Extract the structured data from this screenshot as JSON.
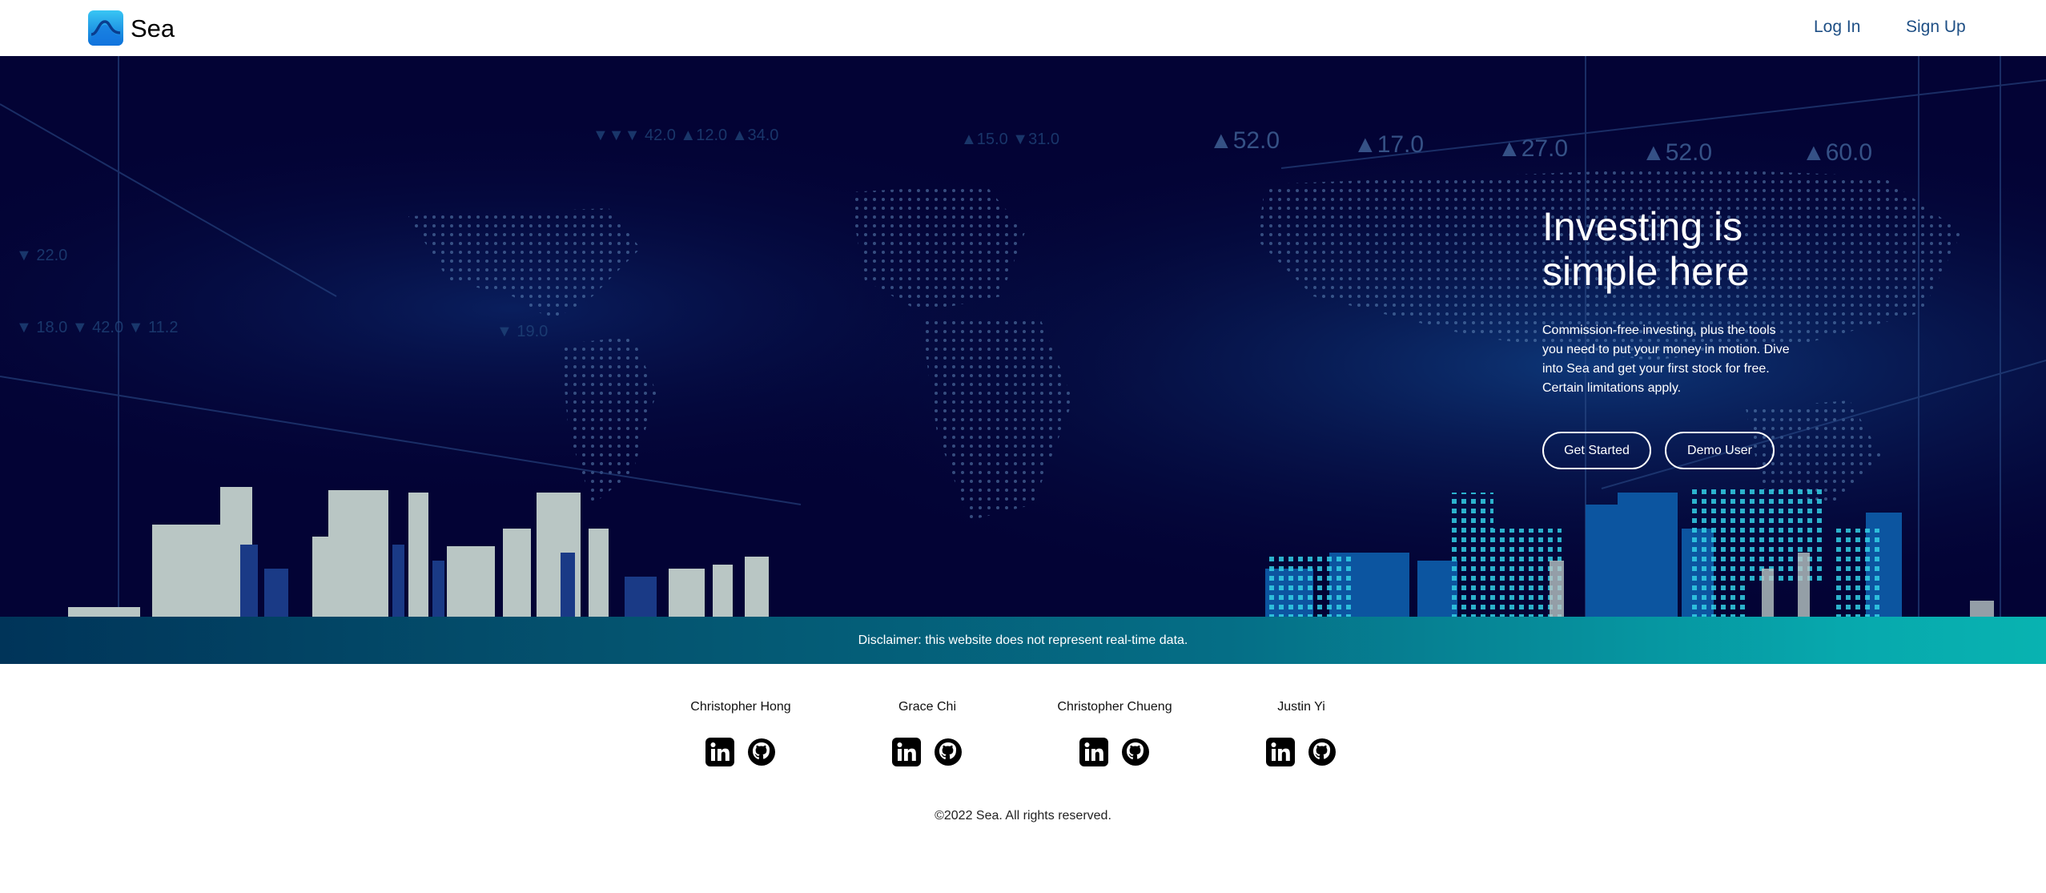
{
  "nav": {
    "brand": "Sea",
    "login": "Log In",
    "signup": "Sign Up"
  },
  "hero": {
    "title": "Investing is simple here",
    "description": "Commission-free investing, plus the tools you need to put your money in motion. Dive into Sea and get your first stock for free. Certain limitations apply.",
    "get_started": "Get Started",
    "demo_user": "Demo User",
    "ticker_values": [
      "▲52.0",
      "▲17.0",
      "▲27.0",
      "▲52.0",
      "▲60.0"
    ]
  },
  "disclaimer": "Disclaimer: this website does not represent real-time data.",
  "team": [
    {
      "name": "Christopher Hong",
      "icons": [
        "linkedin-icon",
        "github-icon"
      ]
    },
    {
      "name": "Grace Chi",
      "icons": [
        "linkedin-icon",
        "github-icon"
      ]
    },
    {
      "name": "Christopher Chueng",
      "icons": [
        "linkedin-icon",
        "github-icon"
      ]
    },
    {
      "name": "Justin Yi",
      "icons": [
        "linkedin-icon",
        "github-icon"
      ]
    }
  ],
  "copyright": "©2022 Sea. All rights reserved.",
  "colors": {
    "nav_link": "#1e4f85",
    "hero_bg": "#030335",
    "disclaimer_start": "#003459",
    "disclaimer_end": "#08b3b1"
  }
}
